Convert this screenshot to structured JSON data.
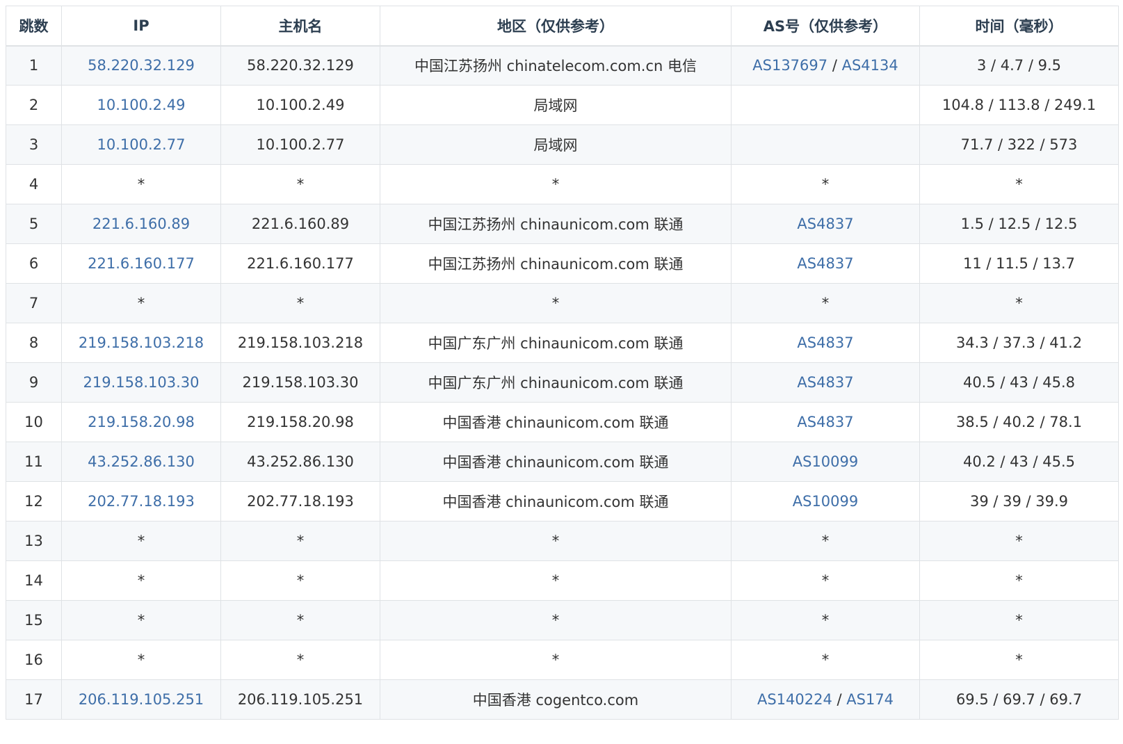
{
  "table": {
    "headers": {
      "hop": "跳数",
      "ip": "IP",
      "host": "主机名",
      "location": "地区（仅供参考）",
      "as": "AS号（仅供参考）",
      "time": "时间（毫秒）"
    },
    "rows": [
      {
        "hop": "1",
        "ip": "58.220.32.129",
        "host": "58.220.32.129",
        "location": "中国江苏扬州 chinatelecom.com.cn 电信",
        "as": [
          "AS137697",
          "AS4134"
        ],
        "time": "3 / 4.7 / 9.5"
      },
      {
        "hop": "2",
        "ip": "10.100.2.49",
        "host": "10.100.2.49",
        "location": "局域网",
        "as": [],
        "time": "104.8 / 113.8 / 249.1"
      },
      {
        "hop": "3",
        "ip": "10.100.2.77",
        "host": "10.100.2.77",
        "location": "局域网",
        "as": [],
        "time": "71.7 / 322 / 573"
      },
      {
        "hop": "4",
        "ip": "*",
        "host": "*",
        "location": "*",
        "as": "*",
        "time": "*"
      },
      {
        "hop": "5",
        "ip": "221.6.160.89",
        "host": "221.6.160.89",
        "location": "中国江苏扬州 chinaunicom.com 联通",
        "as": [
          "AS4837"
        ],
        "time": "1.5 / 12.5 / 12.5"
      },
      {
        "hop": "6",
        "ip": "221.6.160.177",
        "host": "221.6.160.177",
        "location": "中国江苏扬州 chinaunicom.com 联通",
        "as": [
          "AS4837"
        ],
        "time": "11 / 11.5 / 13.7"
      },
      {
        "hop": "7",
        "ip": "*",
        "host": "*",
        "location": "*",
        "as": "*",
        "time": "*"
      },
      {
        "hop": "8",
        "ip": "219.158.103.218",
        "host": "219.158.103.218",
        "location": "中国广东广州 chinaunicom.com 联通",
        "as": [
          "AS4837"
        ],
        "time": "34.3 / 37.3 / 41.2"
      },
      {
        "hop": "9",
        "ip": "219.158.103.30",
        "host": "219.158.103.30",
        "location": "中国广东广州 chinaunicom.com 联通",
        "as": [
          "AS4837"
        ],
        "time": "40.5 / 43 / 45.8"
      },
      {
        "hop": "10",
        "ip": "219.158.20.98",
        "host": "219.158.20.98",
        "location": "中国香港 chinaunicom.com 联通",
        "as": [
          "AS4837"
        ],
        "time": "38.5 / 40.2 / 78.1"
      },
      {
        "hop": "11",
        "ip": "43.252.86.130",
        "host": "43.252.86.130",
        "location": "中国香港 chinaunicom.com 联通",
        "as": [
          "AS10099"
        ],
        "time": "40.2 / 43 / 45.5"
      },
      {
        "hop": "12",
        "ip": "202.77.18.193",
        "host": "202.77.18.193",
        "location": "中国香港 chinaunicom.com 联通",
        "as": [
          "AS10099"
        ],
        "time": "39 / 39 / 39.9"
      },
      {
        "hop": "13",
        "ip": "*",
        "host": "*",
        "location": "*",
        "as": "*",
        "time": "*"
      },
      {
        "hop": "14",
        "ip": "*",
        "host": "*",
        "location": "*",
        "as": "*",
        "time": "*"
      },
      {
        "hop": "15",
        "ip": "*",
        "host": "*",
        "location": "*",
        "as": "*",
        "time": "*"
      },
      {
        "hop": "16",
        "ip": "*",
        "host": "*",
        "location": "*",
        "as": "*",
        "time": "*"
      },
      {
        "hop": "17",
        "ip": "206.119.105.251",
        "host": "206.119.105.251",
        "location": "中国香港 cogentco.com",
        "as": [
          "AS140224",
          "AS174"
        ],
        "time": "69.5 / 69.7 / 69.7"
      }
    ]
  },
  "colors": {
    "link": "#3e6ea8",
    "text": "#333333",
    "header_text": "#2c3e50",
    "border": "#dfe2e5",
    "stripe": "#f6f8fa"
  }
}
